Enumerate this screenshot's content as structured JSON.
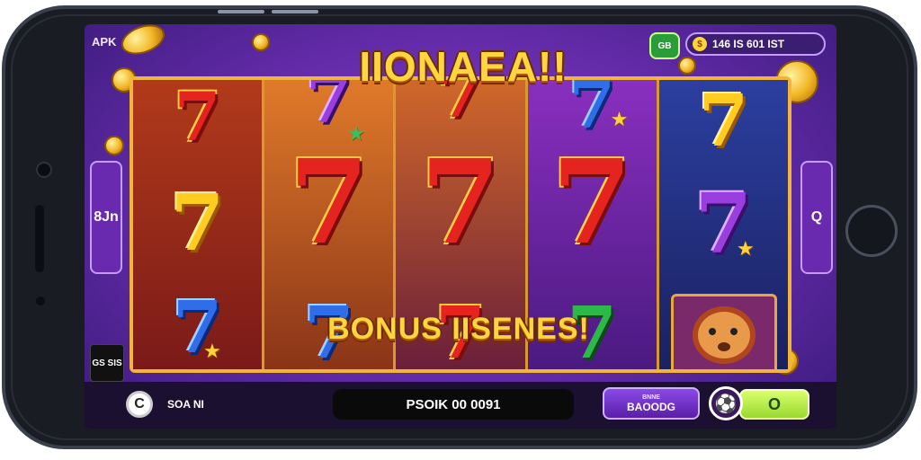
{
  "device": {
    "type": "phone-landscape"
  },
  "topbar": {
    "apk_label": "APK",
    "coin_badge": "GB",
    "balance_text": "146 IS 601 IST"
  },
  "game": {
    "title": "IIONAEA!!",
    "bonus_text": "BONUS IISENES!",
    "left_panel_text": "8Jn",
    "right_panel_text": "Q",
    "small_logo_text": "GS\nSIS",
    "reels": [
      {
        "symbols": [
          "7",
          "7",
          "7"
        ],
        "colors": [
          "red",
          "gold",
          "blue"
        ]
      },
      {
        "symbols": [
          "7",
          "7",
          "7"
        ],
        "colors": [
          "purple",
          "red",
          "blue"
        ]
      },
      {
        "symbols": [
          "7",
          "7",
          "7"
        ],
        "colors": [
          "red",
          "red",
          "red"
        ]
      },
      {
        "symbols": [
          "7",
          "7",
          "7"
        ],
        "colors": [
          "blue",
          "red",
          "green"
        ]
      },
      {
        "symbols": [
          "7",
          "7",
          "lion"
        ],
        "colors": [
          "gold",
          "purple",
          "lion"
        ]
      }
    ]
  },
  "bottombar": {
    "icon_glyph": "C",
    "label": "SOA NI",
    "message": "PSOIK 00 0091",
    "purple_button": {
      "small": "BNNE",
      "label": "BAOODG"
    },
    "ball_icon": "soccer-ball-icon",
    "green_button": "O"
  },
  "colors": {
    "accent_gold": "#ffd640",
    "screen_purple": "#6a2eb0",
    "green_button": "#9ad830"
  }
}
